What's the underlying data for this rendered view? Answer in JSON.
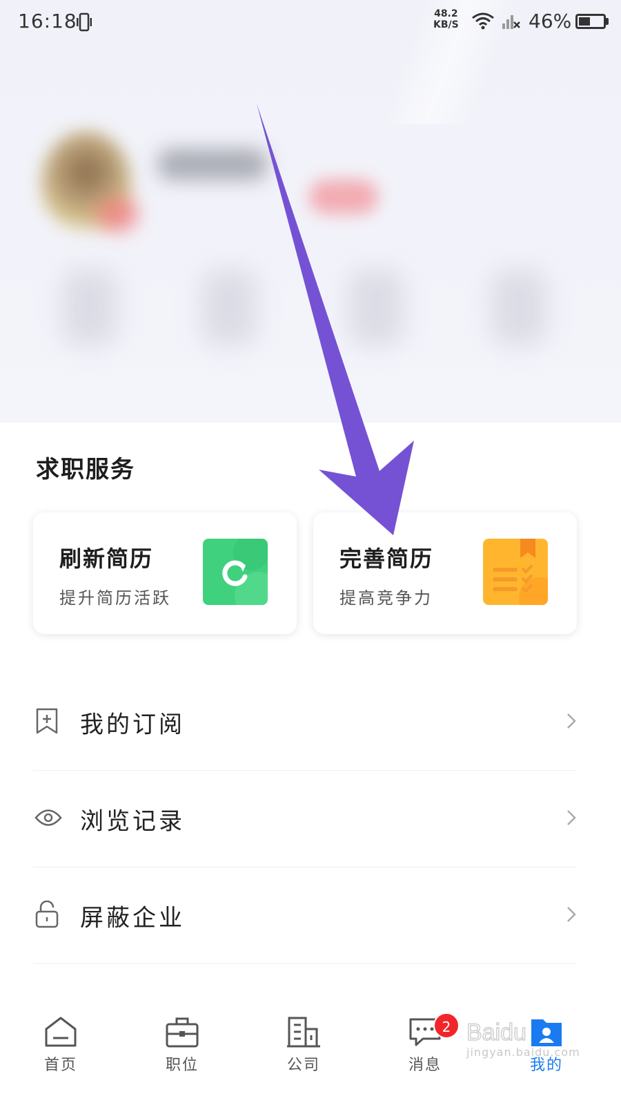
{
  "status_bar": {
    "time": "16:18",
    "net_speed_value": "48.2",
    "net_speed_unit": "KB/S",
    "battery_percent": "46%",
    "battery_level": 0.46
  },
  "services": {
    "title": "求职服务",
    "cards": [
      {
        "title": "刷新简历",
        "subtitle": "提升简历活跃",
        "icon": "refresh-icon",
        "color": "#3fd17d"
      },
      {
        "title": "完善简历",
        "subtitle": "提高竞争力",
        "icon": "resume-checklist-icon",
        "color": "#ffb62e"
      }
    ]
  },
  "menu": [
    {
      "label": "我的订阅",
      "icon": "bookmark-add-icon"
    },
    {
      "label": "浏览记录",
      "icon": "eye-icon"
    },
    {
      "label": "屏蔽企业",
      "icon": "unlock-icon"
    }
  ],
  "tab_bar": {
    "tabs": [
      {
        "label": "首页",
        "icon": "home-icon"
      },
      {
        "label": "职位",
        "icon": "briefcase-icon"
      },
      {
        "label": "公司",
        "icon": "building-icon"
      },
      {
        "label": "消息",
        "icon": "message-icon",
        "badge": "2"
      },
      {
        "label": "我的",
        "icon": "profile-icon",
        "active": true
      }
    ],
    "active_color": "#1a7bf0",
    "badge_color": "#f2262a"
  },
  "annotation": {
    "arrow_color": "#7552d4"
  },
  "watermark": {
    "text": "jingyan.baidu.com"
  }
}
